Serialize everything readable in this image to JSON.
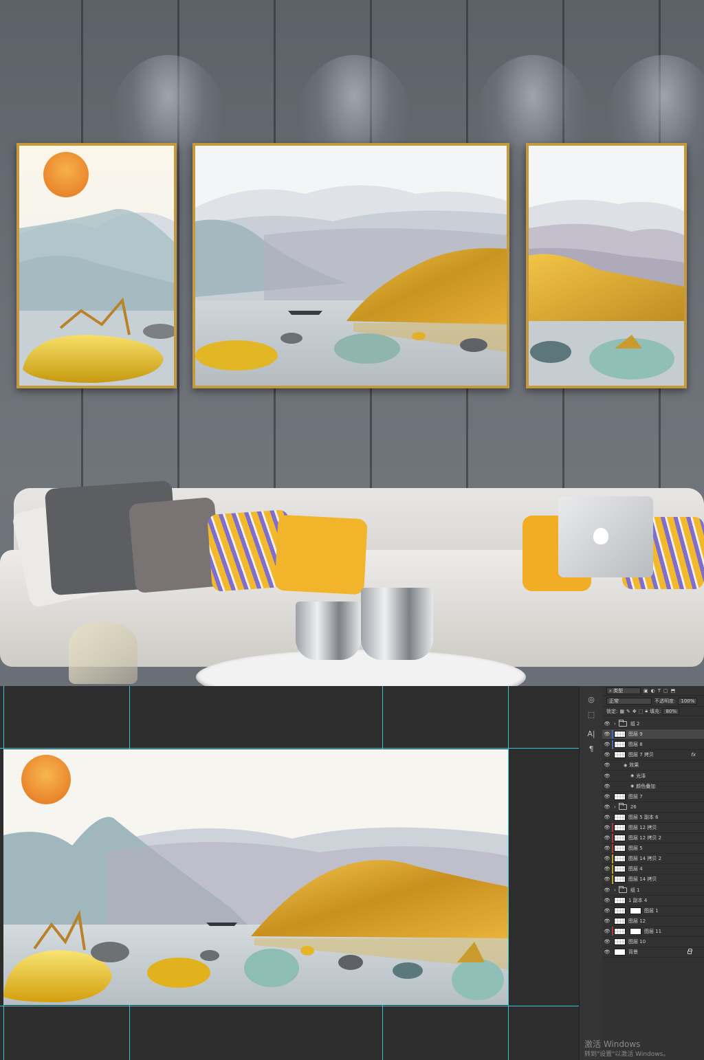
{
  "layers_panel": {
    "search_placeholder": "类型",
    "blend_mode": "正常",
    "opacity_label": "不透明度:",
    "opacity_value": "100%",
    "lock_label": "锁定:",
    "fill_label": "填充:",
    "fill_value": "80%",
    "layers": [
      {
        "name": "组 2",
        "type": "group",
        "visible": true,
        "tag": ""
      },
      {
        "name": "图层 9",
        "type": "layer",
        "visible": true,
        "tag": "#3d6db5",
        "selected": true
      },
      {
        "name": "图层 8",
        "type": "layer",
        "visible": true,
        "tag": "#3d6db5"
      },
      {
        "name": "图层 7 拷贝",
        "type": "layer",
        "visible": true,
        "tag": "",
        "fx": "fx"
      },
      {
        "name": "效果",
        "type": "effect",
        "visible": true,
        "tag": ""
      },
      {
        "name": "光泽",
        "type": "effect-item",
        "visible": true,
        "tag": ""
      },
      {
        "name": "颜色叠加",
        "type": "effect-item",
        "visible": true,
        "tag": ""
      },
      {
        "name": "图层 7",
        "type": "layer",
        "visible": true,
        "tag": ""
      },
      {
        "name": "26",
        "type": "group",
        "visible": true,
        "tag": ""
      },
      {
        "name": "图层 5 副本 6",
        "type": "layer",
        "visible": true,
        "tag": ""
      },
      {
        "name": "图层 12 拷贝",
        "type": "layer",
        "visible": true,
        "tag": "#b03a3a"
      },
      {
        "name": "图层 12 拷贝 2",
        "type": "layer",
        "visible": true,
        "tag": "#b03a3a"
      },
      {
        "name": "图层 5",
        "type": "layer",
        "visible": true,
        "tag": "#b03a3a"
      },
      {
        "name": "图层 14 拷贝 2",
        "type": "layer",
        "visible": true,
        "tag": "#b8a020"
      },
      {
        "name": "图层 4",
        "type": "layer",
        "visible": true,
        "tag": "#b8a020"
      },
      {
        "name": "图层 14 拷贝",
        "type": "layer",
        "visible": true,
        "tag": "#b8a020"
      },
      {
        "name": "组 1",
        "type": "group",
        "visible": true,
        "tag": ""
      },
      {
        "name": "1 副本 4",
        "type": "layer",
        "visible": true,
        "tag": ""
      },
      {
        "name": "图层 1",
        "type": "masked",
        "visible": true,
        "tag": ""
      },
      {
        "name": "图层 12",
        "type": "layer",
        "visible": true,
        "tag": ""
      },
      {
        "name": "图层 11",
        "type": "masked",
        "visible": true,
        "tag": "#b03a3a"
      },
      {
        "name": "图层 10",
        "type": "layer",
        "visible": true,
        "tag": ""
      },
      {
        "name": "背景",
        "type": "background",
        "visible": true,
        "tag": ""
      }
    ]
  },
  "tools": [
    "channels-icon",
    "paths-icon",
    "character-icon",
    "paragraph-icon"
  ],
  "watermark": {
    "line1": "激活 Windows",
    "line2": "转到\"设置\"以激活 Windows。"
  },
  "colors": {
    "frame_gold": "#c49a3c",
    "guide_cyan": "#37c8d8",
    "panel_bg": "#323232",
    "workspace_bg": "#2d2d2d"
  }
}
